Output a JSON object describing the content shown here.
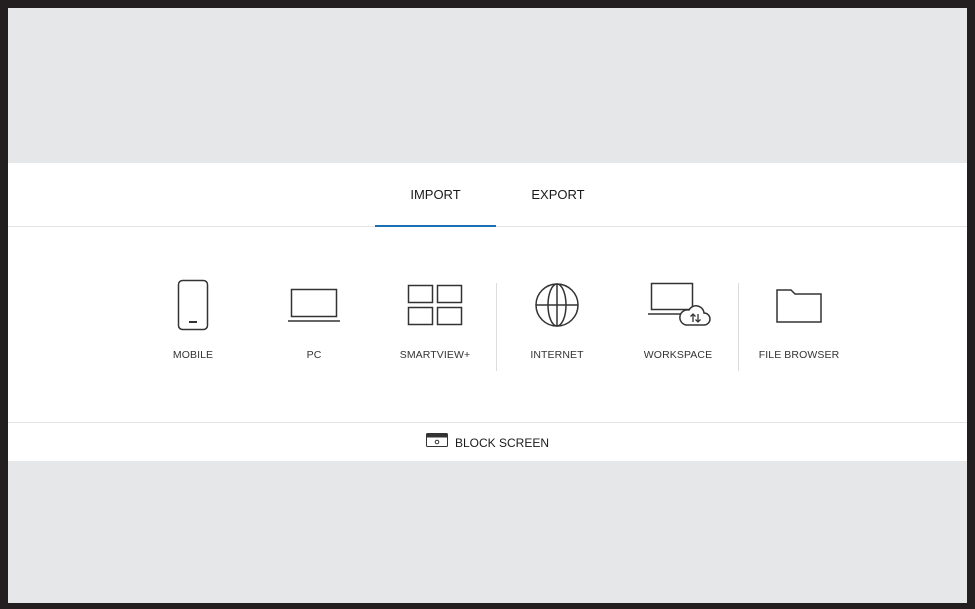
{
  "tabs": [
    {
      "label": "IMPORT",
      "selected": true
    },
    {
      "label": "EXPORT",
      "selected": false
    }
  ],
  "sources": [
    {
      "label": "MOBILE",
      "icon": "mobile-icon"
    },
    {
      "label": "PC",
      "icon": "laptop-icon"
    },
    {
      "label": "SMARTVIEW+",
      "icon": "grid-icon"
    },
    {
      "label": "INTERNET",
      "icon": "globe-icon"
    },
    {
      "label": "WORKSPACE",
      "icon": "workspace-cloud-icon"
    },
    {
      "label": "FILE BROWSER",
      "icon": "folder-icon"
    }
  ],
  "block_screen": {
    "label": "BLOCK SCREEN",
    "icon": "block-screen-icon"
  },
  "colors": {
    "accent": "#1b6fb4",
    "background": "#e6e7e9",
    "panel": "#ffffff",
    "border": "#231f20"
  }
}
